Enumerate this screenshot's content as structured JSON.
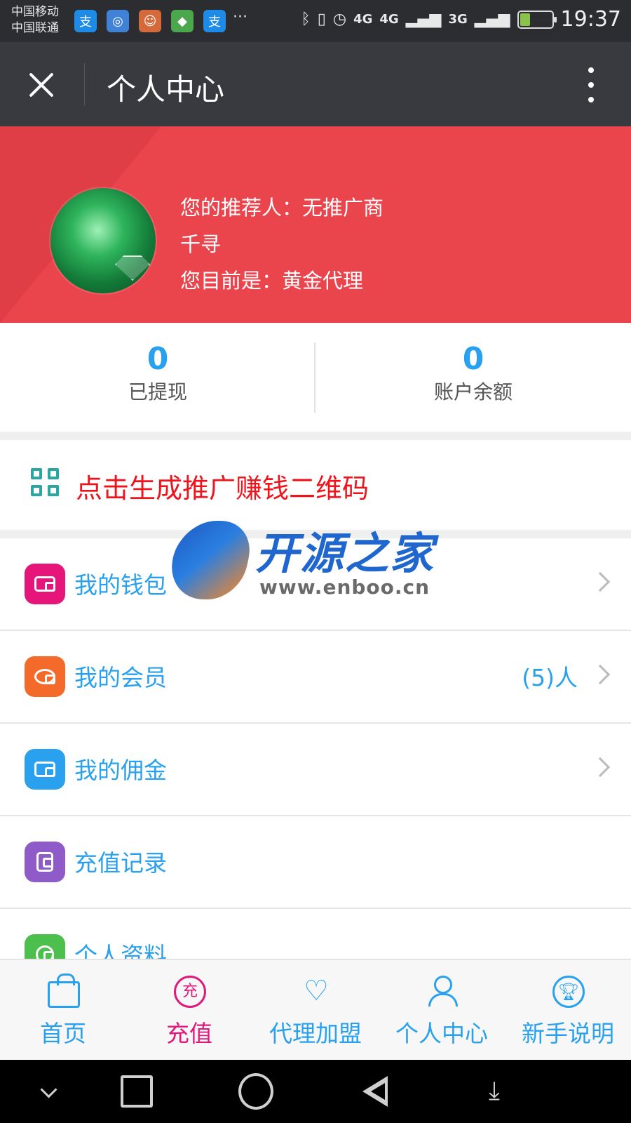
{
  "status_bar": {
    "carrier_1": "中国移动",
    "carrier_2": "中国联通",
    "apps": [
      {
        "icon": "alipay-icon",
        "glyph": "支",
        "color": "#1e8be6"
      },
      {
        "icon": "swirl-app-icon",
        "glyph": "◎",
        "color": "#3f82d6"
      },
      {
        "icon": "cartoon-app-icon",
        "glyph": "☺",
        "color": "#d4693b"
      },
      {
        "icon": "maps-app-icon",
        "glyph": "◆",
        "color": "#4ca64c"
      },
      {
        "icon": "alipay-icon",
        "glyph": "支",
        "color": "#1e8be6"
      }
    ],
    "more": "···",
    "network_1": "4G",
    "network_2": "4G",
    "network_3": "3G",
    "time": "19:37"
  },
  "titlebar": {
    "title": "个人中心"
  },
  "profile": {
    "referrer_line": "您的推荐人：无推广商",
    "username": "千寻",
    "level_line": "您目前是：黄金代理",
    "accent_color": "#ea444d"
  },
  "stats": {
    "withdrawn_value": "0",
    "withdrawn_label": "已提现",
    "balance_value": "0",
    "balance_label": "账户余额"
  },
  "qr": {
    "text": "点击生成推广赚钱二维码"
  },
  "menu": {
    "items": [
      {
        "label": "我的钱包",
        "extra": "",
        "icon": "wallet-icon",
        "color": "#e5157a"
      },
      {
        "label": "我的会员",
        "extra": "(5)人",
        "icon": "members-icon",
        "color": "#f36a2b"
      },
      {
        "label": "我的佣金",
        "extra": "",
        "icon": "commission-icon",
        "color": "#29a1ee"
      },
      {
        "label": "充值记录",
        "extra": "",
        "icon": "recharge-record-icon",
        "color": "#8e5bc8"
      },
      {
        "label": "个人资料",
        "extra": "",
        "icon": "profile-icon",
        "color": "#4cbf4c"
      }
    ]
  },
  "watermark": {
    "title": "开源之家",
    "url": "www.enboo.cn"
  },
  "bottom_nav": {
    "items": [
      {
        "label": "首页",
        "icon": "shopping-bag-icon"
      },
      {
        "label": "充值",
        "icon": "recharge-icon",
        "glyph": "充"
      },
      {
        "label": "代理加盟",
        "icon": "handshake-icon"
      },
      {
        "label": "个人中心",
        "icon": "user-icon"
      },
      {
        "label": "新手说明",
        "icon": "trophy-icon"
      }
    ],
    "active_index": 1,
    "active_color": "#e0197b",
    "color": "#29a1ee"
  }
}
